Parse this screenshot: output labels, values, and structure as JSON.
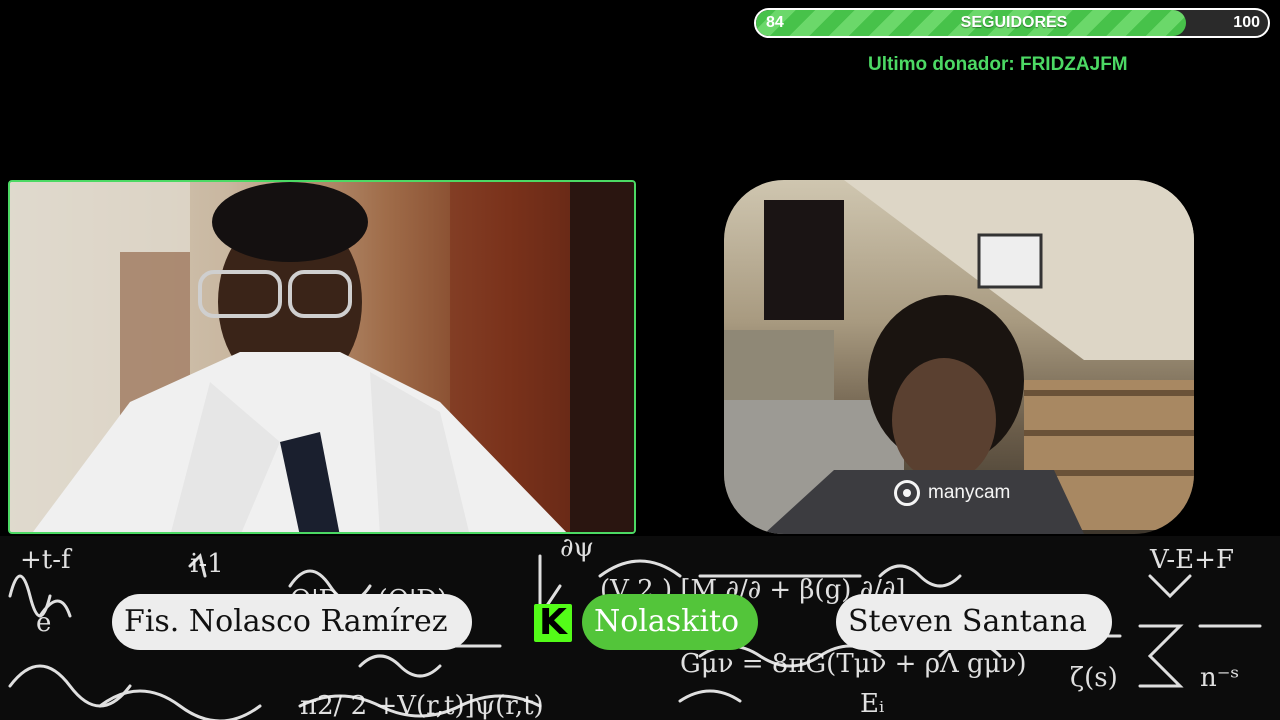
{
  "follower_goal": {
    "current": "84",
    "label": "SEGUIDORES",
    "target": "100",
    "progress": 0.84,
    "fill_color": "#47c24a"
  },
  "last_donor": {
    "text": "Ultimo donador: FRIDZAJFM"
  },
  "host_camera": {
    "border_color": "#4cd964"
  },
  "guest_camera": {
    "watermark_text": "manycam",
    "watermark_icon": "manycam-logo-icon"
  },
  "name_tags": {
    "host": "Fis. Nolasco Ramírez",
    "channel": "Nolaskito",
    "channel_icon": "kick-logo-icon",
    "guest": "Steven Santana"
  },
  "colors": {
    "accent_green": "#4cd964",
    "kick_green": "#53fc18",
    "pill_light": "#ededed"
  }
}
